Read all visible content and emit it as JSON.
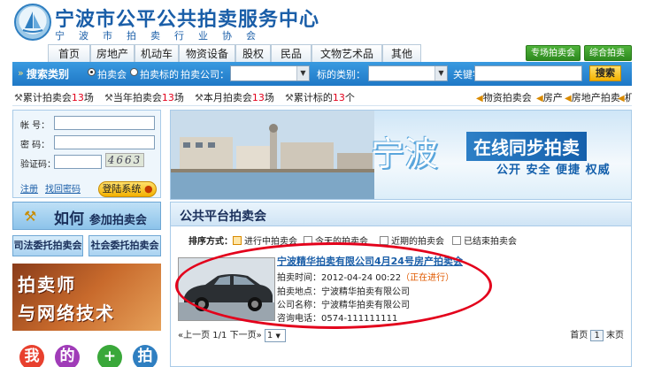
{
  "header": {
    "title": "宁波市公平公共拍卖服务中心",
    "subtitle": "宁  波  市  拍  卖  行  业  协  会"
  },
  "nav": {
    "tabs": [
      "首页",
      "房地产",
      "机动车",
      "物资设备",
      "股权",
      "民品",
      "文物艺术品",
      "其他"
    ],
    "buttons": [
      "专场拍卖会",
      "综合拍卖会"
    ]
  },
  "search": {
    "label": "搜索类别",
    "radio_auction": "拍卖会",
    "radio_lot": "拍卖标的",
    "company_label": "拍卖公司：",
    "category_label": "标的类别：",
    "keyword_label": "关键字：",
    "button": "搜索"
  },
  "stats": {
    "items": [
      {
        "label": "累计拍卖会",
        "value": "13",
        "unit": "场"
      },
      {
        "label": "当年拍卖会",
        "value": "13",
        "unit": "场"
      },
      {
        "label": "本月拍卖会",
        "value": "13",
        "unit": "场"
      },
      {
        "label": "累计标的",
        "value": "13",
        "unit": "个"
      }
    ],
    "ticker": [
      "物资拍卖会",
      "房产",
      "房地产拍卖",
      "机"
    ]
  },
  "login": {
    "account_label": "帐  号：",
    "password_label": "密  码：",
    "captcha_label": "验证码：",
    "captcha_text": "4663",
    "register": "注册",
    "forgot": "找回密码",
    "login_button": "登陆系统"
  },
  "sidebar": {
    "how_join": "如何",
    "how_join_small": "参加拍卖会",
    "judicial": "司法委托拍卖会",
    "social": "社会委托拍卖会",
    "promo_line1": "拍卖师",
    "promo_line2": "与网络技术",
    "bottom_balls": [
      "我",
      "的",
      "+",
      "拍"
    ]
  },
  "banner": {
    "city": "宁波",
    "online": "在线同步拍卖",
    "slogan": "公开 安全 便捷 权威"
  },
  "panel": {
    "title": "公共平台拍卖会",
    "sort_label": "排序方式：",
    "sort_options": [
      "进行中拍卖会",
      "今天的拍卖会",
      "近期的拍卖会",
      "已结束拍卖会"
    ],
    "item": {
      "title": "宁波精华拍卖有限公司4月24号房产拍卖会",
      "time_label": "拍卖时间：",
      "time_value": "2012-04-24 00:22",
      "status": "（正在进行）",
      "place_label": "拍卖地点：",
      "place_value": "宁波精华拍卖有限公司",
      "company_label": "公司名称：",
      "company_value": "宁波精华拍卖有限公司",
      "phone_label": "咨询电话：",
      "phone_value": "0574-111111111"
    },
    "pager": {
      "left": "«上一页 1/1 下一页»",
      "select": "1",
      "first": "首页",
      "current": "1",
      "last": "末页"
    }
  }
}
